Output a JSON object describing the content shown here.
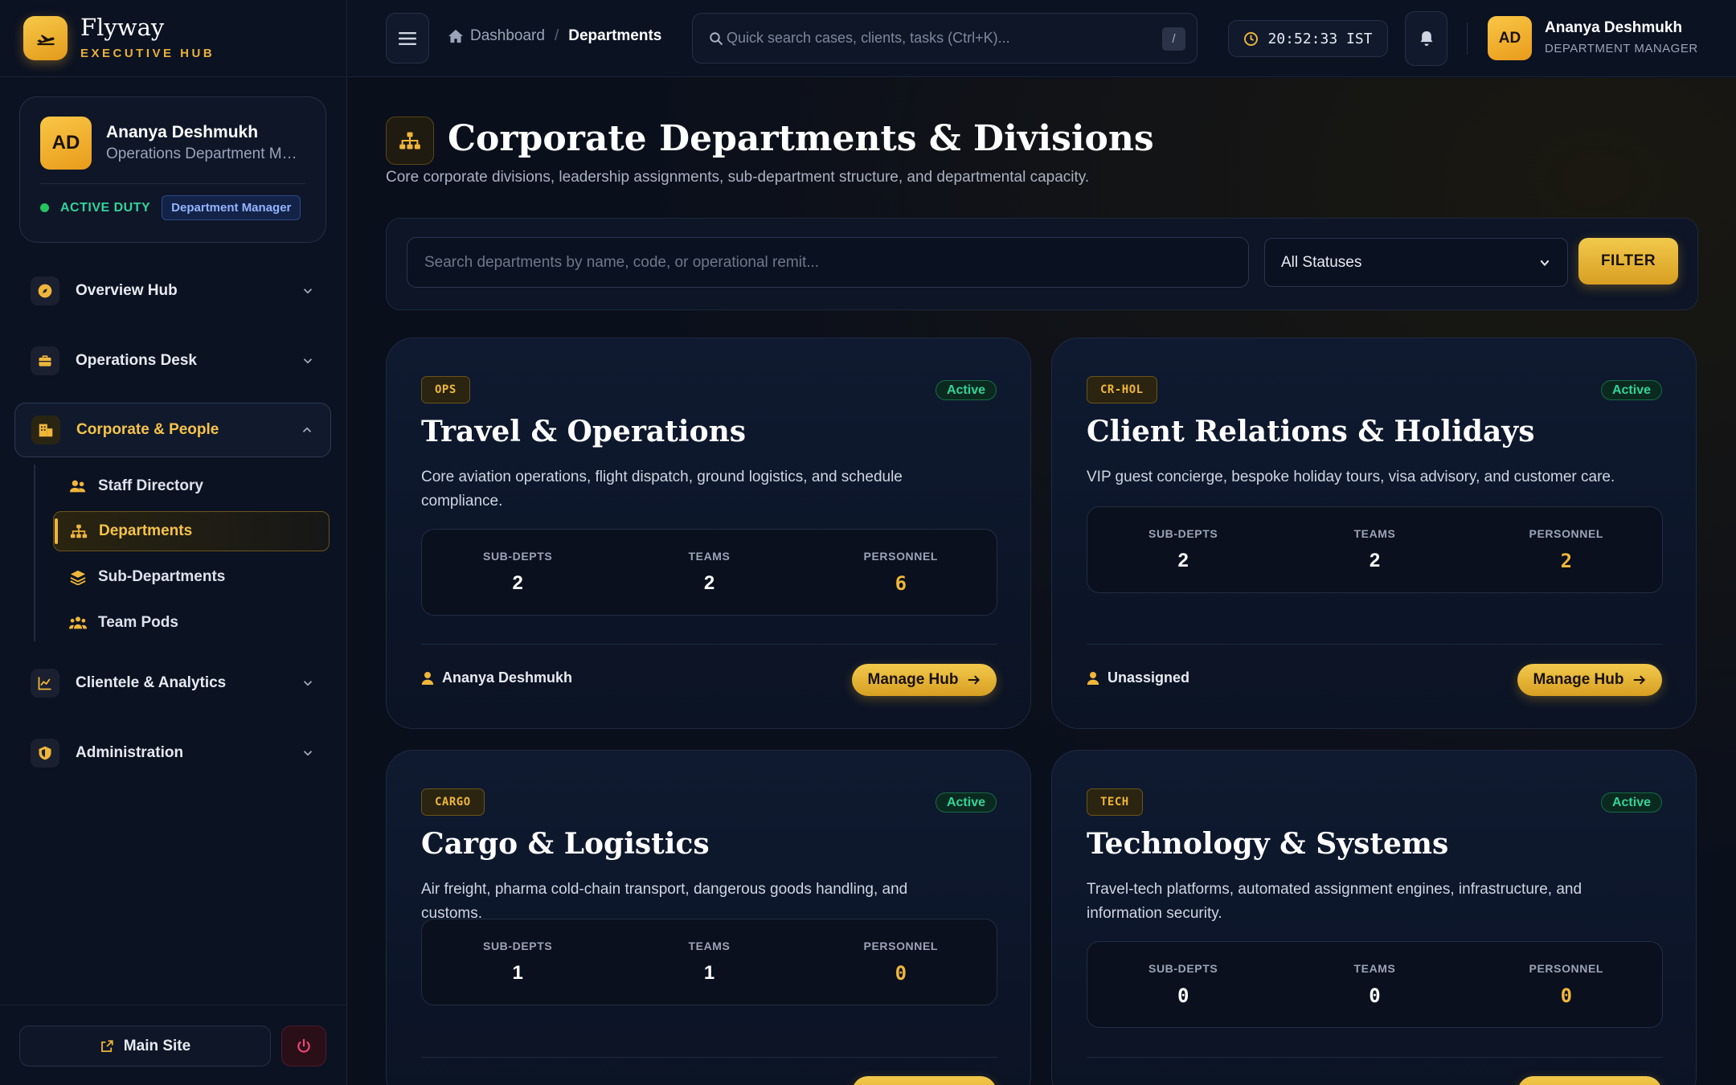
{
  "brand": {
    "name": "Flyway",
    "subtitle": "EXECUTIVE HUB"
  },
  "profile": {
    "initials": "AD",
    "name": "Ananya Deshmukh",
    "title": "Operations Department Manager",
    "duty": "ACTIVE DUTY",
    "role_badge": "Department Manager"
  },
  "nav": {
    "groups": [
      {
        "label": "Overview Hub",
        "icon": "compass-icon"
      },
      {
        "label": "Operations Desk",
        "icon": "briefcase-icon"
      },
      {
        "label": "Corporate & People",
        "icon": "building-icon"
      },
      {
        "label": "Clientele & Analytics",
        "icon": "chart-line-icon"
      },
      {
        "label": "Administration",
        "icon": "shield-icon"
      }
    ],
    "sub_items": [
      {
        "label": "Staff Directory",
        "icon": "users-icon"
      },
      {
        "label": "Departments",
        "icon": "sitemap-icon"
      },
      {
        "label": "Sub-Departments",
        "icon": "layers-icon"
      },
      {
        "label": "Team Pods",
        "icon": "people-group-icon"
      }
    ]
  },
  "footer": {
    "main_site": "Main Site"
  },
  "topbar": {
    "crumb_home": "Dashboard",
    "crumb_sep": "/",
    "crumb_current": "Departments",
    "search_placeholder": "Quick search cases, clients, tasks (Ctrl+K)...",
    "search_kbd": "/",
    "clock": "20:52:33 IST",
    "user_initials": "AD",
    "user_name": "Ananya Deshmukh",
    "user_role": "DEPARTMENT MANAGER"
  },
  "page": {
    "title": "Corporate Departments & Divisions",
    "subtitle": "Core corporate divisions, leadership assignments, sub-department structure, and departmental capacity."
  },
  "filters": {
    "search_placeholder": "Search departments by name, code, or operational remit...",
    "status_value": "All Statuses",
    "filter_label": "FILTER"
  },
  "labels": {
    "sub_depts": "SUB-DEPTS",
    "teams": "TEAMS",
    "personnel": "PERSONNEL",
    "manage": "Manage Hub"
  },
  "departments": [
    {
      "code": "OPS",
      "status": "Active",
      "name": "Travel & Operations",
      "description": "Core aviation operations, flight dispatch, ground logistics, and schedule compliance.",
      "sub_depts": "2",
      "teams": "2",
      "personnel": "6",
      "lead": "Ananya Deshmukh"
    },
    {
      "code": "CR-HOL",
      "status": "Active",
      "name": "Client Relations & Holidays",
      "description": "VIP guest concierge, bespoke holiday tours, visa advisory, and customer care.",
      "sub_depts": "2",
      "teams": "2",
      "personnel": "2",
      "lead": "Unassigned"
    },
    {
      "code": "CARGO",
      "status": "Active",
      "name": "Cargo & Logistics",
      "description": "Air freight, pharma cold-chain transport, dangerous goods handling, and customs.",
      "sub_depts": "1",
      "teams": "1",
      "personnel": "0",
      "lead": ""
    },
    {
      "code": "TECH",
      "status": "Active",
      "name": "Technology & Systems",
      "description": "Travel-tech platforms, automated assignment engines, infrastructure, and information security.",
      "sub_depts": "0",
      "teams": "0",
      "personnel": "0",
      "lead": ""
    }
  ],
  "colors": {
    "accent": "#f0b63a",
    "success": "#34d399",
    "bg": "#0a0f1c"
  }
}
